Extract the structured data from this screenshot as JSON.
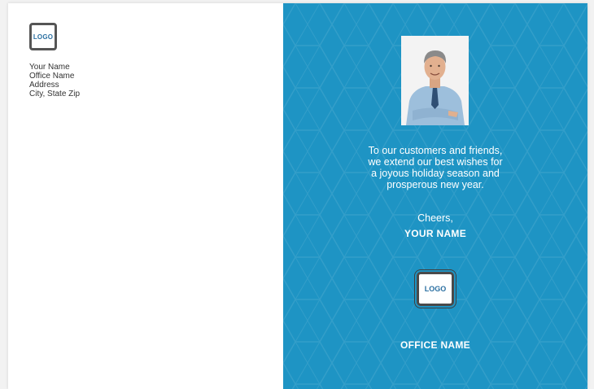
{
  "return_address": {
    "logo_text": "LOGO",
    "lines": [
      "Your Name",
      "Office Name",
      "Address",
      "City, State Zip"
    ]
  },
  "greeting": {
    "message_lines": [
      "To our customers and friends,",
      "we extend our best wishes for",
      "a joyous holiday season and",
      "prosperous new year."
    ],
    "closing": "Cheers,",
    "signature": "YOUR NAME",
    "logo_text": "LOGO",
    "office_name": "OFFICE NAME"
  },
  "colors": {
    "panel_background": "#1e94c4",
    "card_background": "#ffffff"
  }
}
